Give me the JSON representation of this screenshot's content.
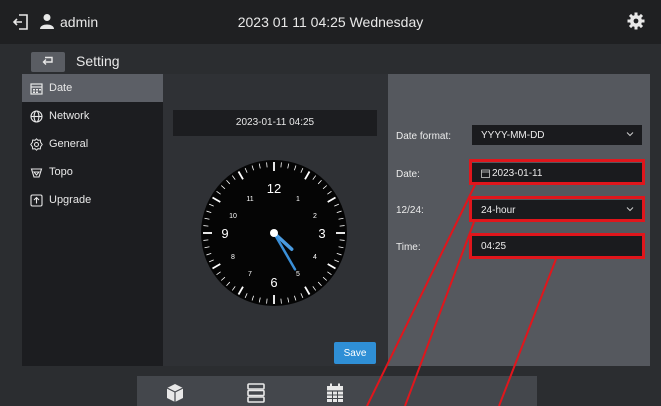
{
  "header": {
    "username": "admin",
    "datetime": "2023 01 11 04:25 Wednesday"
  },
  "page": {
    "title": "Setting"
  },
  "sidebar": {
    "items": [
      {
        "label": "Date",
        "icon": "calendar-icon",
        "active": true
      },
      {
        "label": "Network",
        "icon": "globe-icon",
        "active": false
      },
      {
        "label": "General",
        "icon": "gear-icon",
        "active": false
      },
      {
        "label": "Topo",
        "icon": "topology-icon",
        "active": false
      },
      {
        "label": "Upgrade",
        "icon": "upgrade-icon",
        "active": false
      }
    ]
  },
  "clock": {
    "date_display": "2023-01-11 04:25",
    "numerals": {
      "n12": "12",
      "n1": "1",
      "n2": "2",
      "n3": "3",
      "n4": "4",
      "n5": "5",
      "n6": "6",
      "n7": "7",
      "n8": "8",
      "n9": "9",
      "n10": "10",
      "n11": "11"
    },
    "hour": 4,
    "minute": 25,
    "save_label": "Save"
  },
  "settings": {
    "date_format_label": "Date format:",
    "date_format_value": "YYYY-MM-DD",
    "date_label": "Date:",
    "date_value": "2023-01-11",
    "mode_label": "12/24:",
    "mode_value": "24-hour",
    "time_label": "Time:",
    "time_value": "04:25"
  },
  "colors": {
    "accent": "#2f8fd6",
    "highlight": "#e0161c",
    "hand": "#3a8fd8"
  }
}
